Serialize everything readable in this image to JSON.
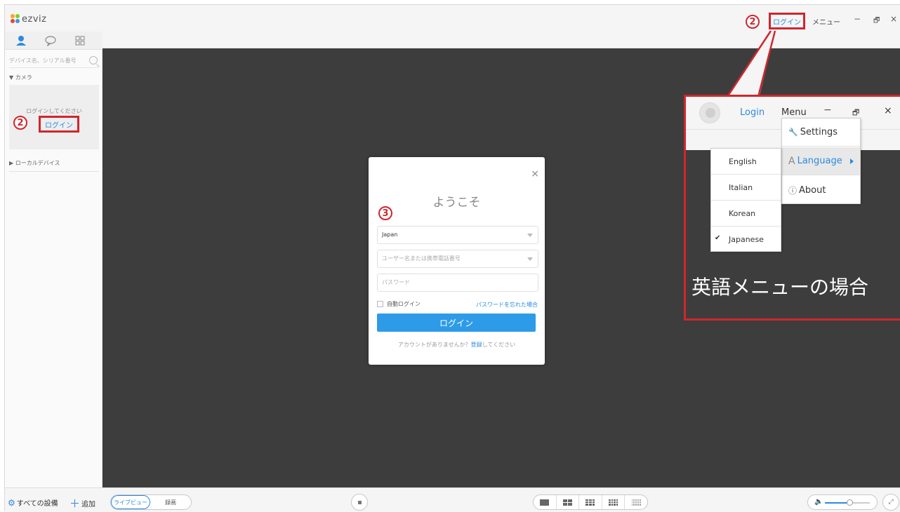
{
  "brand": {
    "logo_text": "ezviz",
    "colors": {
      "accent": "#2a8ae0",
      "annotation": "#d0262d",
      "video_bg": "#3d3d3d"
    }
  },
  "titlebar": {
    "login_label": "ログイン",
    "menu_label": "メニュー",
    "minimize_glyph": "−",
    "restore_glyph": "🗗",
    "close_glyph": "×"
  },
  "annotations": {
    "step2": "2",
    "step3": "3"
  },
  "sidebar": {
    "tabs": [
      "person-icon",
      "chat-icon",
      "grid-icon"
    ],
    "search_placeholder": "デバイス名、シリアル番号",
    "group_camera": "▼ カメラ",
    "please_login": "ログインしてください",
    "login_link": "ログイン",
    "group_local": "▶ ローカルデバイス"
  },
  "bottombar": {
    "all_devices": "すべての設備",
    "add": "追加",
    "live_view": "ライブビュー",
    "recording": "録画",
    "volume_level": 0.55
  },
  "dialog": {
    "close_glyph": "×",
    "title": "ようこそ",
    "region_value": "Japan",
    "username_placeholder": "ユーザー名または携帯電話番号",
    "password_placeholder": "パスワード",
    "auto_login": "自動ログイン",
    "forgot_password": "パスワードを忘れた場合",
    "login_button": "ログイン",
    "no_account": "アカウントがありませんか？",
    "register": "登録",
    "register_suffix": "してください"
  },
  "callout": {
    "login_label": "Login",
    "menu_label": "Menu",
    "minimize_glyph": "−",
    "restore_glyph": "🗗",
    "close_glyph": "×",
    "menu_items": [
      {
        "icon": "wrench-icon",
        "glyph": "🔧",
        "label": "Settings"
      },
      {
        "icon": "language-icon",
        "glyph": "A",
        "label": "Language"
      },
      {
        "icon": "info-icon",
        "glyph": "ⓘ",
        "label": "About"
      }
    ],
    "languages": [
      {
        "label": "English",
        "checked": false
      },
      {
        "label": "Italian",
        "checked": false
      },
      {
        "label": "Korean",
        "checked": false
      },
      {
        "label": "Japanese",
        "checked": true
      }
    ],
    "check_glyph": "✔",
    "caption": "英語メニューの場合"
  }
}
